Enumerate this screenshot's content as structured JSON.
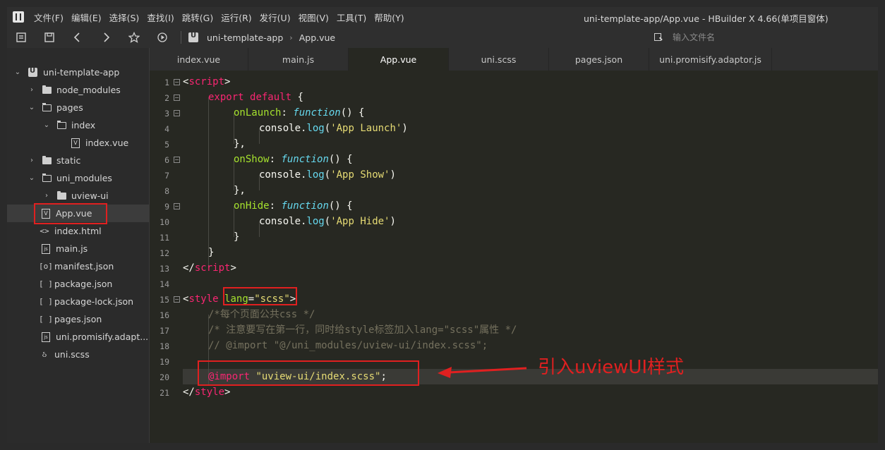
{
  "window": {
    "title": "uni-template-app/App.vue - HBuilder X 4.66(单项目窗体)"
  },
  "menu": [
    "文件(F)",
    "编辑(E)",
    "选择(S)",
    "查找(I)",
    "跳转(G)",
    "运行(R)",
    "发行(U)",
    "视图(V)",
    "工具(T)",
    "帮助(Y)"
  ],
  "toolbar": {
    "icons": [
      "new-file-icon",
      "save-icon",
      "back-icon",
      "forward-icon",
      "star-icon",
      "run-icon"
    ],
    "breadcrumb": [
      "uni-template-app",
      "App.vue"
    ],
    "file_search_placeholder": "输入文件名"
  },
  "sidebar": {
    "items": [
      {
        "label": "uni-template-app",
        "type": "project",
        "expanded": true
      },
      {
        "label": "node_modules",
        "type": "folder",
        "expanded": false
      },
      {
        "label": "pages",
        "type": "folder",
        "expanded": true
      },
      {
        "label": "index",
        "type": "folder",
        "expanded": true
      },
      {
        "label": "index.vue",
        "type": "vue"
      },
      {
        "label": "static",
        "type": "folder",
        "expanded": false
      },
      {
        "label": "uni_modules",
        "type": "folder",
        "expanded": true
      },
      {
        "label": "uview-ui",
        "type": "folder",
        "expanded": false
      },
      {
        "label": "App.vue",
        "type": "vue",
        "selected": true
      },
      {
        "label": "index.html",
        "type": "html",
        "glyph": "<>"
      },
      {
        "label": "main.js",
        "type": "js"
      },
      {
        "label": "manifest.json",
        "type": "json-config",
        "glyph": "[o]"
      },
      {
        "label": "package.json",
        "type": "json",
        "glyph": "[ ]"
      },
      {
        "label": "package-lock.json",
        "type": "json",
        "glyph": "[ ]"
      },
      {
        "label": "pages.json",
        "type": "json",
        "glyph": "[ ]"
      },
      {
        "label": "uni.promisify.adapt...",
        "type": "js"
      },
      {
        "label": "uni.scss",
        "type": "scss",
        "glyph": "ઠ"
      }
    ]
  },
  "tabs": [
    {
      "label": "index.vue"
    },
    {
      "label": "main.js"
    },
    {
      "label": "App.vue",
      "active": true
    },
    {
      "label": "uni.scss"
    },
    {
      "label": "pages.json"
    },
    {
      "label": "uni.promisify.adaptor.js"
    }
  ],
  "editor": {
    "line_numbers": [
      "1",
      "2",
      "3",
      "4",
      "5",
      "6",
      "7",
      "8",
      "9",
      "10",
      "11",
      "12",
      "13",
      "14",
      "15",
      "16",
      "17",
      "18",
      "19",
      "20",
      "21"
    ],
    "current_line": 20,
    "code": {
      "l1_a": "<",
      "l1_b": "script",
      "l1_c": ">",
      "l2_a": "export",
      "l2_b": " ",
      "l2_c": "default",
      "l2_d": " {",
      "l3_a": "onLaunch",
      "l3_b": ": ",
      "l3_c": "function",
      "l3_d": "() {",
      "l4_a": "console",
      "l4_b": ".",
      "l4_c": "log",
      "l4_d": "(",
      "l4_e": "'App Launch'",
      "l4_f": ")",
      "l5_a": "},",
      "l6_a": "onShow",
      "l6_b": ": ",
      "l6_c": "function",
      "l6_d": "() {",
      "l7_a": "console",
      "l7_b": ".",
      "l7_c": "log",
      "l7_d": "(",
      "l7_e": "'App Show'",
      "l7_f": ")",
      "l8_a": "},",
      "l9_a": "onHide",
      "l9_b": ": ",
      "l9_c": "function",
      "l9_d": "() {",
      "l10_a": "console",
      "l10_b": ".",
      "l10_c": "log",
      "l10_d": "(",
      "l10_e": "'App Hide'",
      "l10_f": ")",
      "l11_a": "}",
      "l12_a": "}",
      "l13_a": "</",
      "l13_b": "script",
      "l13_c": ">",
      "l15_a": "<",
      "l15_b": "style",
      "l15_c": " ",
      "l15_d": "lang",
      "l15_e": "=",
      "l15_f": "\"scss\"",
      "l15_g": ">",
      "l16_a": "/*每个页面公共css */",
      "l17_a": "/* 注意要写在第一行，同时给style标签加入lang=\"scss\"属性 */",
      "l18_a": "// @import \"@/uni_modules/uview-ui/index.scss\";",
      "l20_a": "@import",
      "l20_b": " ",
      "l20_c": "\"uview-ui/index.scss\"",
      "l20_d": ";",
      "l21_a": "</",
      "l21_b": "style",
      "l21_c": ">"
    }
  },
  "annotation": {
    "text": "引入uviewUI样式",
    "color": "#e02020"
  }
}
